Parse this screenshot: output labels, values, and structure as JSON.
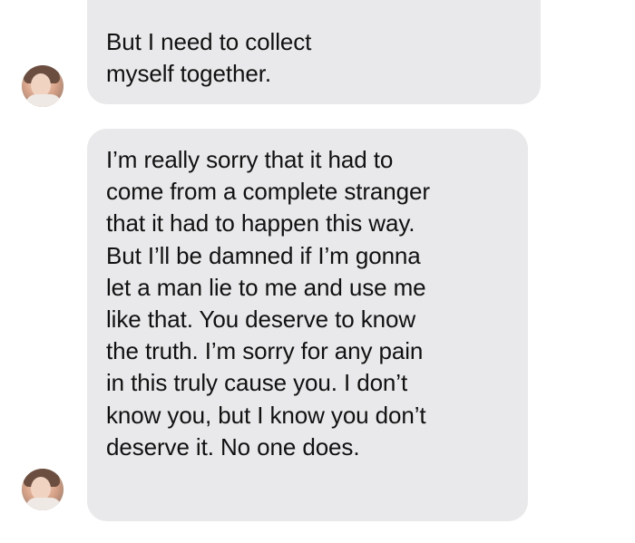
{
  "conversation": {
    "messages": [
      {
        "sender_avatar": "avatar-icon",
        "lines": [
          "But I need to collect",
          "myself together."
        ]
      },
      {
        "sender_avatar": "avatar-icon",
        "lines": [
          "I’m really sorry that it had to",
          "come from a complete stranger",
          "that it had to happen this way.",
          "But I’ll be damned if I’m gonna",
          "let a man lie to me and use me",
          "like that. You deserve to know",
          "the truth. I’m sorry for any pain",
          "in this truly cause you. I don’t",
          "know you, but I know you don’t",
          "deserve it. No one does."
        ]
      }
    ]
  },
  "colors": {
    "bubble_background": "#e9e9eb",
    "text": "#111111",
    "page_background": "#ffffff"
  }
}
